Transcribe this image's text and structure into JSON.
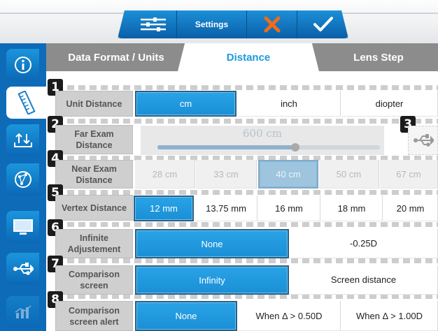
{
  "toolbar": {
    "title": "Settings",
    "icons": [
      "sliders-icon",
      "close-icon",
      "check-icon"
    ],
    "cancel_color": "#f26a1b",
    "ok_color": "#ffffff"
  },
  "sidebar": {
    "items": [
      {
        "icon": "info-icon",
        "active": false
      },
      {
        "icon": "ruler-icon",
        "active": true
      },
      {
        "icon": "import-export-icon",
        "active": false
      },
      {
        "icon": "globe-network-icon",
        "active": false
      },
      {
        "icon": "monitor-icon",
        "active": false
      },
      {
        "icon": "usb-icon",
        "active": false
      },
      {
        "icon": "chart-icon",
        "active": false,
        "disabled": true
      }
    ]
  },
  "tabs": [
    {
      "label": "Data Format / Units",
      "active": false
    },
    {
      "label": "Distance",
      "active": true
    },
    {
      "label": "Lens Step",
      "active": false
    }
  ],
  "rows": [
    {
      "number": "1",
      "label": "Unit Distance",
      "options": [
        {
          "label": "cm",
          "selected": true
        },
        {
          "label": "inch",
          "selected": false
        },
        {
          "label": "diopter",
          "selected": false
        }
      ]
    },
    {
      "number": "2",
      "label": "Far Exam Distance",
      "slider": {
        "value_text": "600 cm",
        "level": 0.62
      },
      "side_number": "3",
      "side_icon": "usb-icon"
    },
    {
      "number": "4",
      "label": "Near Exam Distance",
      "disabled": true,
      "options": [
        {
          "label": "28 cm",
          "selected": false
        },
        {
          "label": "33 cm",
          "selected": false
        },
        {
          "label": "40 cm",
          "selected": true
        },
        {
          "label": "50 cm",
          "selected": false
        },
        {
          "label": "67 cm",
          "selected": false
        }
      ]
    },
    {
      "number": "5",
      "label": "Vertex Distance",
      "options": [
        {
          "label": "12 mm",
          "selected": true
        },
        {
          "label": "13.75 mm",
          "selected": false
        },
        {
          "label": "16 mm",
          "selected": false
        },
        {
          "label": "18 mm",
          "selected": false
        },
        {
          "label": "20 mm",
          "selected": false
        }
      ]
    },
    {
      "number": "6",
      "label": "Infinite Adjustement",
      "options": [
        {
          "label": "None",
          "selected": true
        },
        {
          "label": "-0.25D",
          "selected": false
        }
      ]
    },
    {
      "number": "7",
      "label": "Comparison screen",
      "options": [
        {
          "label": "Infinity",
          "selected": true
        },
        {
          "label": "Screen distance",
          "selected": false
        }
      ]
    },
    {
      "number": "8",
      "label": "Comparison screen alert",
      "options": [
        {
          "label": "None",
          "selected": true
        },
        {
          "label": "When Δ > 0.50D",
          "selected": false
        },
        {
          "label": "When Δ > 1.00D",
          "selected": false
        }
      ]
    }
  ],
  "colors": {
    "accent": "#1a9be0",
    "sidebar": "#0e6bb8",
    "tab_bar": "#8c8c8c"
  }
}
